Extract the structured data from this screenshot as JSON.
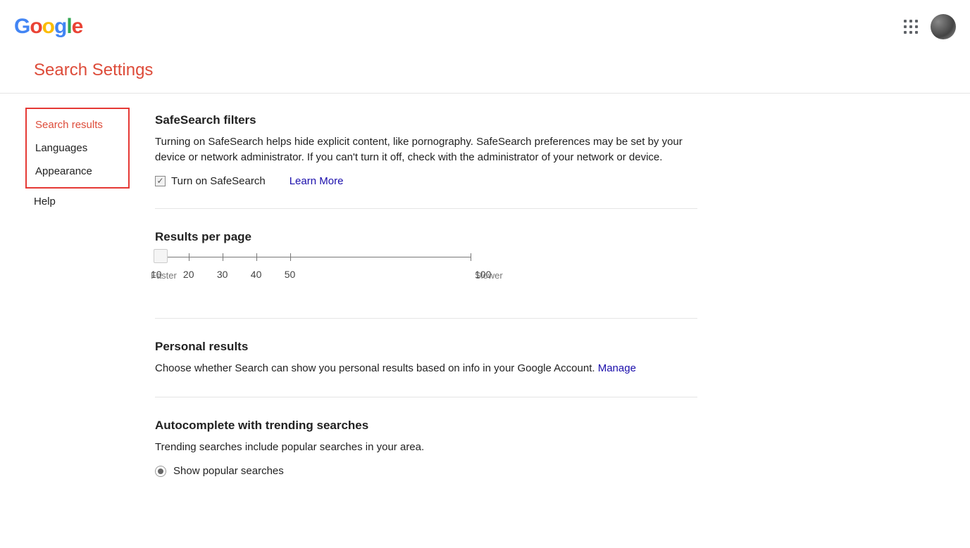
{
  "page_title": "Search Settings",
  "sidebar": {
    "items": [
      "Search results",
      "Languages",
      "Appearance"
    ],
    "help": "Help"
  },
  "sections": {
    "safesearch": {
      "title": "SafeSearch filters",
      "desc": "Turning on SafeSearch helps hide explicit content, like pornography. SafeSearch preferences may be set by your device or network administrator. If you can't turn it off, check with the administrator of your network or device.",
      "checkbox_label": "Turn on SafeSearch",
      "learn_more": "Learn More"
    },
    "results_per_page": {
      "title": "Results per page",
      "ticks": [
        "10",
        "20",
        "30",
        "40",
        "50",
        "100"
      ],
      "left_sub": "Faster",
      "right_sub": "Slower"
    },
    "personal": {
      "title": "Personal results",
      "desc": "Choose whether Search can show you personal results based on info in your Google Account.",
      "manage": "Manage"
    },
    "autocomplete": {
      "title": "Autocomplete with trending searches",
      "desc": "Trending searches include popular searches in your area.",
      "option1": "Show popular searches"
    }
  }
}
